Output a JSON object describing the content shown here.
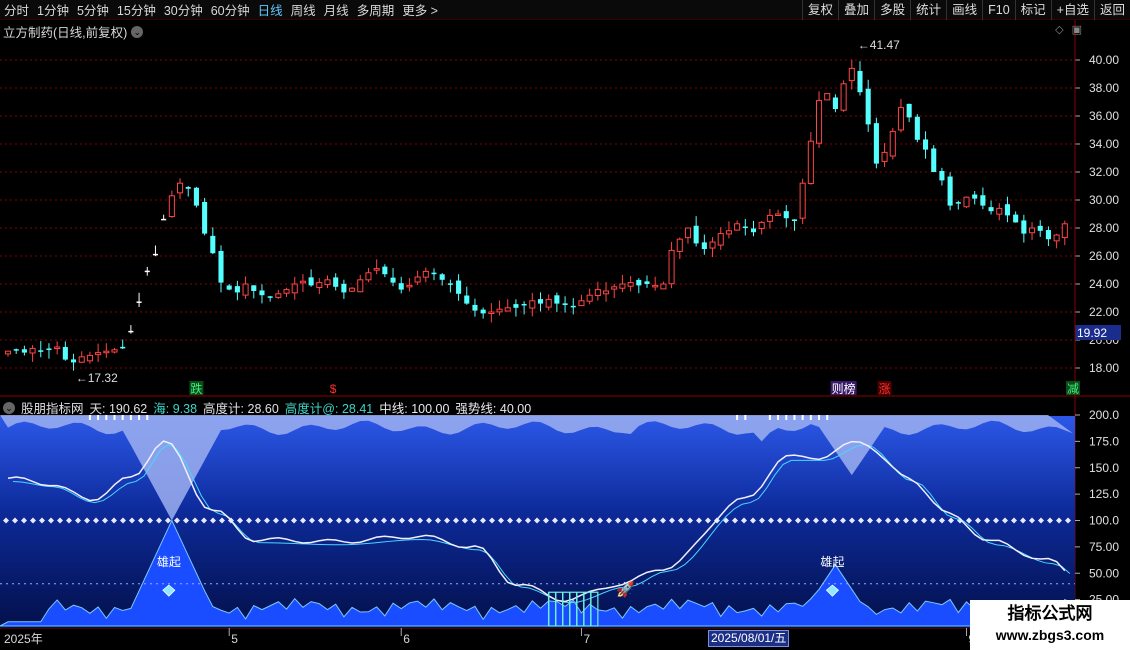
{
  "toolbar": {
    "periods": [
      "分时",
      "1分钟",
      "5分钟",
      "15分钟",
      "30分钟",
      "60分钟",
      "日线",
      "周线",
      "月线",
      "多周期",
      "更多 >"
    ],
    "active_period": "日线",
    "tools": [
      "复权",
      "叠加",
      "多股",
      "统计",
      "画线",
      "F10",
      "标记",
      "+自选",
      "返回"
    ]
  },
  "main_chart": {
    "title": "立方制药(日线,前复权)",
    "current_price_tag": "19.92",
    "high_label": "41.47",
    "low_label": "17.32",
    "markers": [
      {
        "text": "跌",
        "color": "#3ef07a",
        "bg": "#0a4d1a"
      },
      {
        "text": "$",
        "color": "#ff3030",
        "bg": ""
      },
      {
        "text": "则榜",
        "color": "#ffffff",
        "bg": "#3a1a6a"
      },
      {
        "text": "涨",
        "color": "#ff3030",
        "bg": "#4a0000"
      },
      {
        "text": "减",
        "color": "#3ef07a",
        "bg": "#0a4d1a"
      }
    ],
    "price_axis": [
      "40.00",
      "38.00",
      "36.00",
      "34.00",
      "32.00",
      "30.00",
      "28.00",
      "26.00",
      "24.00",
      "22.00",
      "20.00",
      "18.00"
    ]
  },
  "indicator": {
    "name": "股朋指标网",
    "tian_label": "天:",
    "tian_value": "190.62",
    "hai_label": "海:",
    "hai_value": "9.38",
    "gdj_label": "高度计:",
    "gdj_value": "28.60",
    "gdj2_label": "高度计@:",
    "gdj2_value": "28.41",
    "mid_label": "中线:",
    "mid_value": "100.00",
    "strong_label": "强势线:",
    "strong_value": "40.00",
    "axis": [
      "200.0",
      "175.0",
      "150.0",
      "125.0",
      "100.0",
      "75.00",
      "50.00",
      "25.00"
    ],
    "rise_labels": [
      "雄起",
      "雄起"
    ]
  },
  "time_axis": {
    "labels": [
      "2025年",
      "5",
      "6",
      "7",
      "9"
    ],
    "cursor_date": "2025/08/01/五"
  },
  "watermark": {
    "line1": "指标公式网",
    "line2": "www.zbgs3.com"
  },
  "colors": {
    "up": "#ff4545",
    "down": "#54ffff",
    "grid": "#8a0000",
    "accent": "#5ec8ff"
  }
}
